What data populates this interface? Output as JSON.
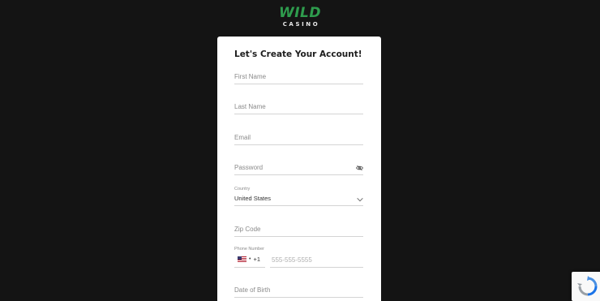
{
  "brand": {
    "name": "WILD",
    "sub": "CASINO",
    "color": "#2e9c4d"
  },
  "form": {
    "title": "Let's Create Your Account!",
    "first_name": {
      "placeholder": "First Name"
    },
    "last_name": {
      "placeholder": "Last Name"
    },
    "email": {
      "placeholder": "Email"
    },
    "password": {
      "placeholder": "Password",
      "icon": "eye-slash-icon"
    },
    "country": {
      "label": "Country",
      "value": "United States",
      "icon": "chevron-down-icon"
    },
    "zip": {
      "placeholder": "Zip Code"
    },
    "phone": {
      "label": "Phone Number",
      "flag": "us-flag-icon",
      "dial_code": "+1",
      "placeholder": "555-555-5555"
    },
    "dob": {
      "placeholder": "Date of Birth"
    }
  },
  "recaptcha": {
    "icon": "recaptcha-icon"
  },
  "colors": {
    "background": "#141414",
    "card": "#ffffff",
    "brand_green": "#2e9c4d"
  }
}
